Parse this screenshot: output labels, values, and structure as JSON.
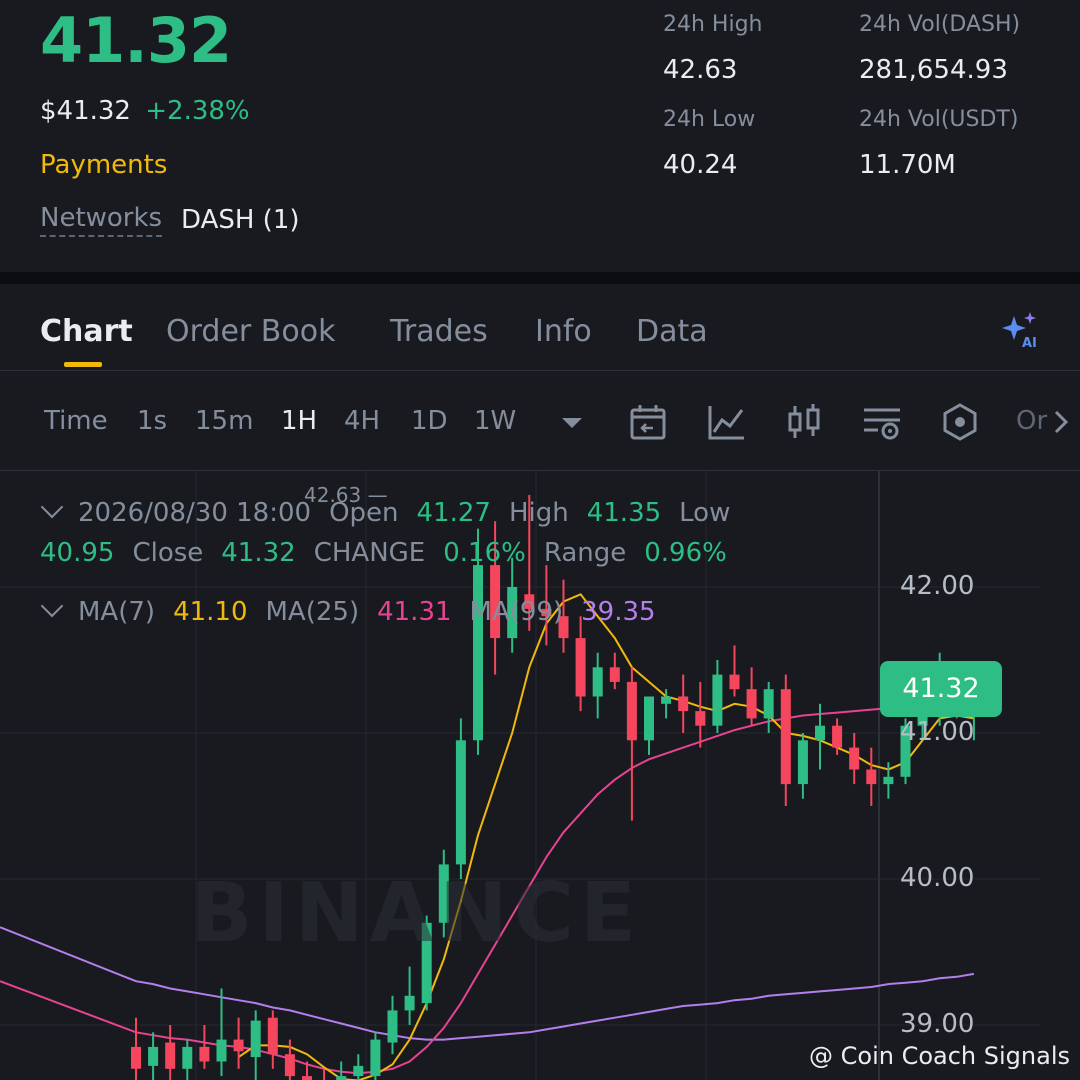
{
  "ticker": {
    "last_price": "41.32",
    "usd_price": "$41.32",
    "change_pct": "+2.38%",
    "category": "Payments",
    "networks_label": "Networks",
    "networks_value": "DASH (1)"
  },
  "stats": {
    "high_label": "24h High",
    "high_value": "42.63",
    "low_label": "24h Low",
    "low_value": "40.24",
    "vol_base_label": "24h Vol(DASH)",
    "vol_base_value": "281,654.93",
    "vol_quote_label": "24h Vol(USDT)",
    "vol_quote_value": "11.70M"
  },
  "tabs": [
    "Chart",
    "Order Book",
    "Trades",
    "Info",
    "Data"
  ],
  "intervals": [
    "Time",
    "1s",
    "15m",
    "1H",
    "4H",
    "1D",
    "1W"
  ],
  "active_interval": "1H",
  "toolbar_more": "Or",
  "ohlc": {
    "timestamp": "2026/08/30 18:00",
    "open_label": "Open",
    "open": "41.27",
    "high_label": "High",
    "high": "41.35",
    "low_label": "Low",
    "low": "40.95",
    "close_label": "Close",
    "close": "41.32",
    "change_label": "CHANGE",
    "change": "0.16%",
    "range_label": "Range",
    "range": "0.96%"
  },
  "ma": {
    "ma7_label": "MA(7)",
    "ma7": "41.10",
    "ma25_label": "MA(25)",
    "ma25": "41.31",
    "ma99_label": "MA(99)",
    "ma99": "39.35"
  },
  "chart_high_marker": "42.63 —",
  "watermark": "BINANCE",
  "current_price_tag": "41.32",
  "credit": "@ Coin Coach Signals",
  "colors": {
    "up": "#2ebd85",
    "down": "#f6465d",
    "accent": "#f0b90b",
    "ma7": "#f0b90b",
    "ma25": "#e84393",
    "ma99": "#b37feb"
  },
  "chart_data": {
    "type": "candlestick",
    "y_ticks": [
      "42.00",
      "41.00",
      "40.00",
      "39.00"
    ],
    "ylim": [
      38.65,
      42.6
    ],
    "candles": [
      {
        "o": 38.85,
        "h": 39.05,
        "l": 38.55,
        "c": 38.7
      },
      {
        "o": 38.72,
        "h": 38.95,
        "l": 38.55,
        "c": 38.85
      },
      {
        "o": 38.88,
        "h": 39.0,
        "l": 38.6,
        "c": 38.7
      },
      {
        "o": 38.7,
        "h": 38.9,
        "l": 38.55,
        "c": 38.85
      },
      {
        "o": 38.85,
        "h": 39.0,
        "l": 38.7,
        "c": 38.75
      },
      {
        "o": 38.75,
        "h": 39.25,
        "l": 38.65,
        "c": 38.9
      },
      {
        "o": 38.9,
        "h": 39.05,
        "l": 38.7,
        "c": 38.82
      },
      {
        "o": 38.78,
        "h": 39.1,
        "l": 38.6,
        "c": 39.03
      },
      {
        "o": 39.05,
        "h": 39.1,
        "l": 38.7,
        "c": 38.8
      },
      {
        "o": 38.8,
        "h": 38.9,
        "l": 38.6,
        "c": 38.65
      },
      {
        "o": 38.65,
        "h": 38.75,
        "l": 38.4,
        "c": 38.55
      },
      {
        "o": 38.55,
        "h": 38.7,
        "l": 38.4,
        "c": 38.45
      },
      {
        "o": 38.45,
        "h": 38.75,
        "l": 38.4,
        "c": 38.65
      },
      {
        "o": 38.65,
        "h": 38.8,
        "l": 38.55,
        "c": 38.72
      },
      {
        "o": 38.65,
        "h": 38.95,
        "l": 38.55,
        "c": 38.9
      },
      {
        "o": 38.88,
        "h": 39.2,
        "l": 38.8,
        "c": 39.1
      },
      {
        "o": 39.1,
        "h": 39.4,
        "l": 39.0,
        "c": 39.2
      },
      {
        "o": 39.15,
        "h": 39.75,
        "l": 39.1,
        "c": 39.7
      },
      {
        "o": 39.7,
        "h": 40.2,
        "l": 39.6,
        "c": 40.1
      },
      {
        "o": 40.1,
        "h": 41.1,
        "l": 40.0,
        "c": 40.95
      },
      {
        "o": 40.95,
        "h": 42.4,
        "l": 40.85,
        "c": 42.15
      },
      {
        "o": 42.15,
        "h": 42.45,
        "l": 41.4,
        "c": 41.65
      },
      {
        "o": 41.65,
        "h": 42.2,
        "l": 41.55,
        "c": 42.0
      },
      {
        "o": 41.95,
        "h": 42.63,
        "l": 41.7,
        "c": 41.85
      },
      {
        "o": 41.85,
        "h": 42.15,
        "l": 41.6,
        "c": 41.8
      },
      {
        "o": 41.8,
        "h": 42.05,
        "l": 41.55,
        "c": 41.65
      },
      {
        "o": 41.65,
        "h": 41.8,
        "l": 41.15,
        "c": 41.25
      },
      {
        "o": 41.25,
        "h": 41.55,
        "l": 41.1,
        "c": 41.45
      },
      {
        "o": 41.45,
        "h": 41.55,
        "l": 41.3,
        "c": 41.35
      },
      {
        "o": 41.35,
        "h": 41.45,
        "l": 40.4,
        "c": 40.95
      },
      {
        "o": 40.95,
        "h": 41.25,
        "l": 40.85,
        "c": 41.25
      },
      {
        "o": 41.2,
        "h": 41.3,
        "l": 41.1,
        "c": 41.25
      },
      {
        "o": 41.25,
        "h": 41.4,
        "l": 41.0,
        "c": 41.15
      },
      {
        "o": 41.15,
        "h": 41.35,
        "l": 40.9,
        "c": 41.05
      },
      {
        "o": 41.05,
        "h": 41.5,
        "l": 41.0,
        "c": 41.4
      },
      {
        "o": 41.4,
        "h": 41.6,
        "l": 41.25,
        "c": 41.3
      },
      {
        "o": 41.3,
        "h": 41.45,
        "l": 41.05,
        "c": 41.1
      },
      {
        "o": 41.1,
        "h": 41.35,
        "l": 41.0,
        "c": 41.3
      },
      {
        "o": 41.3,
        "h": 41.4,
        "l": 40.5,
        "c": 40.65
      },
      {
        "o": 40.65,
        "h": 41.0,
        "l": 40.55,
        "c": 40.95
      },
      {
        "o": 40.95,
        "h": 41.2,
        "l": 40.75,
        "c": 41.05
      },
      {
        "o": 41.05,
        "h": 41.1,
        "l": 40.85,
        "c": 40.9
      },
      {
        "o": 40.9,
        "h": 41.0,
        "l": 40.65,
        "c": 40.75
      },
      {
        "o": 40.75,
        "h": 40.9,
        "l": 40.5,
        "c": 40.65
      },
      {
        "o": 40.65,
        "h": 40.8,
        "l": 40.55,
        "c": 40.7
      },
      {
        "o": 40.7,
        "h": 41.1,
        "l": 40.65,
        "c": 41.05
      },
      {
        "o": 41.05,
        "h": 41.3,
        "l": 40.95,
        "c": 41.25
      },
      {
        "o": 41.25,
        "h": 41.55,
        "l": 41.05,
        "c": 41.35
      },
      {
        "o": 41.35,
        "h": 41.4,
        "l": 41.1,
        "c": 41.2
      },
      {
        "o": 41.27,
        "h": 41.35,
        "l": 40.95,
        "c": 41.32
      }
    ],
    "ma7": [
      null,
      null,
      null,
      null,
      null,
      null,
      38.78,
      38.86,
      38.86,
      38.85,
      38.8,
      38.71,
      38.63,
      38.62,
      38.66,
      38.73,
      38.9,
      39.15,
      39.45,
      39.85,
      40.3,
      40.65,
      41.0,
      41.45,
      41.75,
      41.9,
      41.95,
      41.8,
      41.65,
      41.45,
      41.35,
      41.25,
      41.22,
      41.18,
      41.15,
      41.2,
      41.18,
      41.12,
      41.0,
      40.98,
      40.95,
      40.9,
      40.85,
      40.78,
      40.75,
      40.8,
      40.95,
      41.1,
      41.12,
      41.1
    ],
    "ma25": [
      38.95,
      38.93,
      38.91,
      38.9,
      38.88,
      38.86,
      38.85,
      38.83,
      38.8,
      38.77,
      38.73,
      38.7,
      38.68,
      38.67,
      38.68,
      38.7,
      38.75,
      38.85,
      38.98,
      39.15,
      39.35,
      39.55,
      39.75,
      39.95,
      40.15,
      40.32,
      40.45,
      40.58,
      40.68,
      40.76,
      40.82,
      40.86,
      40.9,
      40.94,
      40.98,
      41.02,
      41.05,
      41.08,
      41.1,
      41.12,
      41.13,
      41.14,
      41.15,
      41.16,
      41.17,
      41.18,
      41.22,
      41.27,
      41.3,
      41.31
    ],
    "ma99": [
      39.3,
      39.28,
      39.25,
      39.23,
      39.21,
      39.19,
      39.17,
      39.15,
      39.12,
      39.1,
      39.07,
      39.04,
      39.01,
      38.98,
      38.95,
      38.93,
      38.91,
      38.9,
      38.9,
      38.91,
      38.92,
      38.93,
      38.94,
      38.95,
      38.97,
      38.99,
      39.01,
      39.03,
      39.05,
      39.07,
      39.09,
      39.11,
      39.13,
      39.14,
      39.15,
      39.17,
      39.18,
      39.2,
      39.21,
      39.22,
      39.23,
      39.24,
      39.25,
      39.26,
      39.28,
      39.29,
      39.3,
      39.32,
      39.33,
      39.35
    ]
  }
}
